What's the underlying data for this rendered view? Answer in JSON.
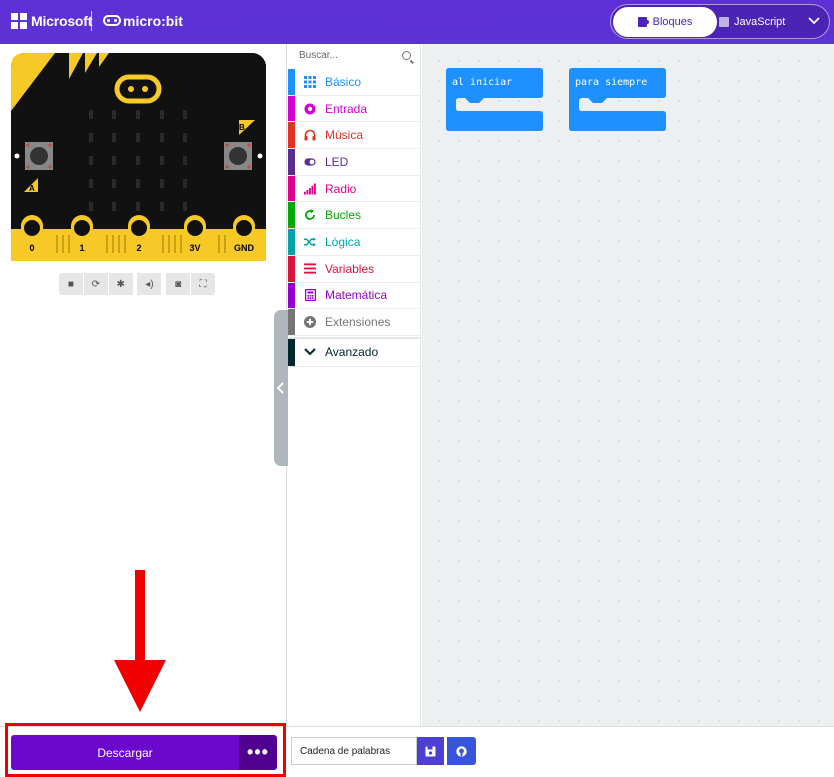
{
  "header": {
    "brand": "Microsoft",
    "product": "micro:bit",
    "modes": {
      "blocks": "Bloques",
      "javascript": "JavaScript",
      "active": "blocks"
    }
  },
  "simulator": {
    "pins": [
      "0",
      "1",
      "2",
      "3V",
      "GND"
    ],
    "button_a": "A",
    "button_b": "B",
    "controls": [
      "stop-icon",
      "restart-icon",
      "debug-icon",
      "sound-icon",
      "screenshot-icon",
      "fullscreen-icon"
    ]
  },
  "toolbox": {
    "search_placeholder": "Buscar...",
    "categories": [
      {
        "label": "Básico",
        "color": "#1e90ff",
        "icon": "grid-icon"
      },
      {
        "label": "Entrada",
        "color": "#d400d4",
        "icon": "target-icon"
      },
      {
        "label": "Música",
        "color": "#e63022",
        "icon": "headphones-icon"
      },
      {
        "label": "LED",
        "color": "#5c2d91",
        "icon": "toggle-icon"
      },
      {
        "label": "Radio",
        "color": "#e3008c",
        "icon": "signal-icon"
      },
      {
        "label": "Bucles",
        "color": "#00aa00",
        "icon": "refresh-icon"
      },
      {
        "label": "Lógica",
        "color": "#00a4a6",
        "icon": "shuffle-icon"
      },
      {
        "label": "Variables",
        "color": "#dc143c",
        "icon": "list-icon"
      },
      {
        "label": "Matemática",
        "color": "#9400d3",
        "icon": "calculator-icon"
      },
      {
        "label": "Extensiones",
        "color": "#757575",
        "icon": "plus-circle-icon"
      }
    ],
    "advanced": {
      "label": "Avanzado",
      "color": "#00272b",
      "icon": "chevron-down-icon"
    }
  },
  "workspace": {
    "blocks": [
      {
        "label": "al iniciar",
        "color": "#1e90ff"
      },
      {
        "label": "para siempre",
        "color": "#1e90ff"
      }
    ]
  },
  "bottom": {
    "download_label": "Descargar",
    "more_label": "•••",
    "project_name": "Cadena de palabras"
  },
  "colors": {
    "header": "#5c2ed5",
    "download": "#6b08cc",
    "annotation": "#f10000"
  }
}
